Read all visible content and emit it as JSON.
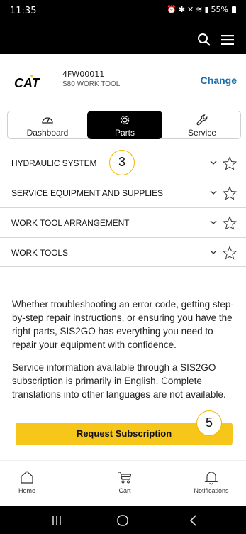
{
  "status_bar": {
    "time": "11:35",
    "icons": [
      "alarm-icon",
      "bluetooth-icon",
      "mute-icon",
      "wifi-icon",
      "signal-icon"
    ],
    "battery": "55%"
  },
  "app_bar": {
    "icons": [
      "search-icon",
      "hamburger-menu-icon"
    ]
  },
  "machine": {
    "brand_logo": "CAT",
    "serial": "4FW00011",
    "model": "S80 WORK TOOL",
    "change_label": "Change"
  },
  "tabs": [
    {
      "label": "Dashboard",
      "icon": "gauge-icon",
      "selected": false
    },
    {
      "label": "Parts",
      "icon": "gear-icon",
      "selected": true
    },
    {
      "label": "Service",
      "icon": "wrench-icon",
      "selected": false
    }
  ],
  "categories": [
    {
      "label": "HYDRAULIC SYSTEM"
    },
    {
      "label": "SERVICE EQUIPMENT AND SUPPLIES"
    },
    {
      "label": "WORK TOOL ARRANGEMENT"
    },
    {
      "label": "WORK TOOLS"
    }
  ],
  "callouts": {
    "badge_a": "3",
    "badge_b": "5"
  },
  "info": {
    "paragraph_1": "Whether troubleshooting an error code, getting step-by-step repair instructions, or ensuring you have the right parts, SIS2GO has everything you need to repair your equipment with confidence.",
    "paragraph_2": "Service information available through a SIS2GO subscription is primarily in English. Complete translations into other languages are not available."
  },
  "subscribe_label": "Request Subscription",
  "bottom_nav": [
    {
      "label": "Home",
      "icon": "home-icon"
    },
    {
      "label": "Cart",
      "icon": "cart-icon"
    },
    {
      "label": "Notifications",
      "icon": "bell-icon"
    }
  ],
  "colors": {
    "accent_yellow": "#f7c61a",
    "link_blue": "#1d6ea8",
    "header_black": "#000000"
  }
}
